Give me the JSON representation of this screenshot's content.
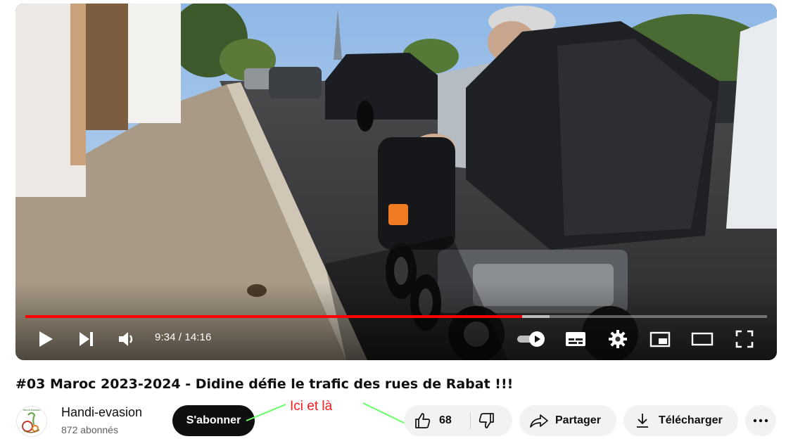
{
  "player": {
    "time_label": "9:34 / 14:16",
    "progress_played": 0.67,
    "progress_buffered": 0.707,
    "accent_color": "#ff0000",
    "icons": [
      "play-icon",
      "next-icon",
      "volume-icon",
      "autoplay-toggle-icon",
      "subtitles-icon",
      "settings-icon",
      "miniplayer-icon",
      "theater-icon",
      "fullscreen-icon"
    ]
  },
  "video": {
    "title": "#03 Maroc 2023-2024 - Didine défie le trafic des rues de Rabat !!!"
  },
  "channel": {
    "name": "Handi-evasion",
    "subscribers": "872 abonnés",
    "avatar_text": "Handi-évasion",
    "subscribe_label": "S'abonner"
  },
  "annotation": {
    "text": "Ici et là",
    "color": "#ff1a1a",
    "line_color": "#66ff66"
  },
  "actions": {
    "like_count": "68",
    "share_label": "Partager",
    "download_label": "Télécharger"
  }
}
